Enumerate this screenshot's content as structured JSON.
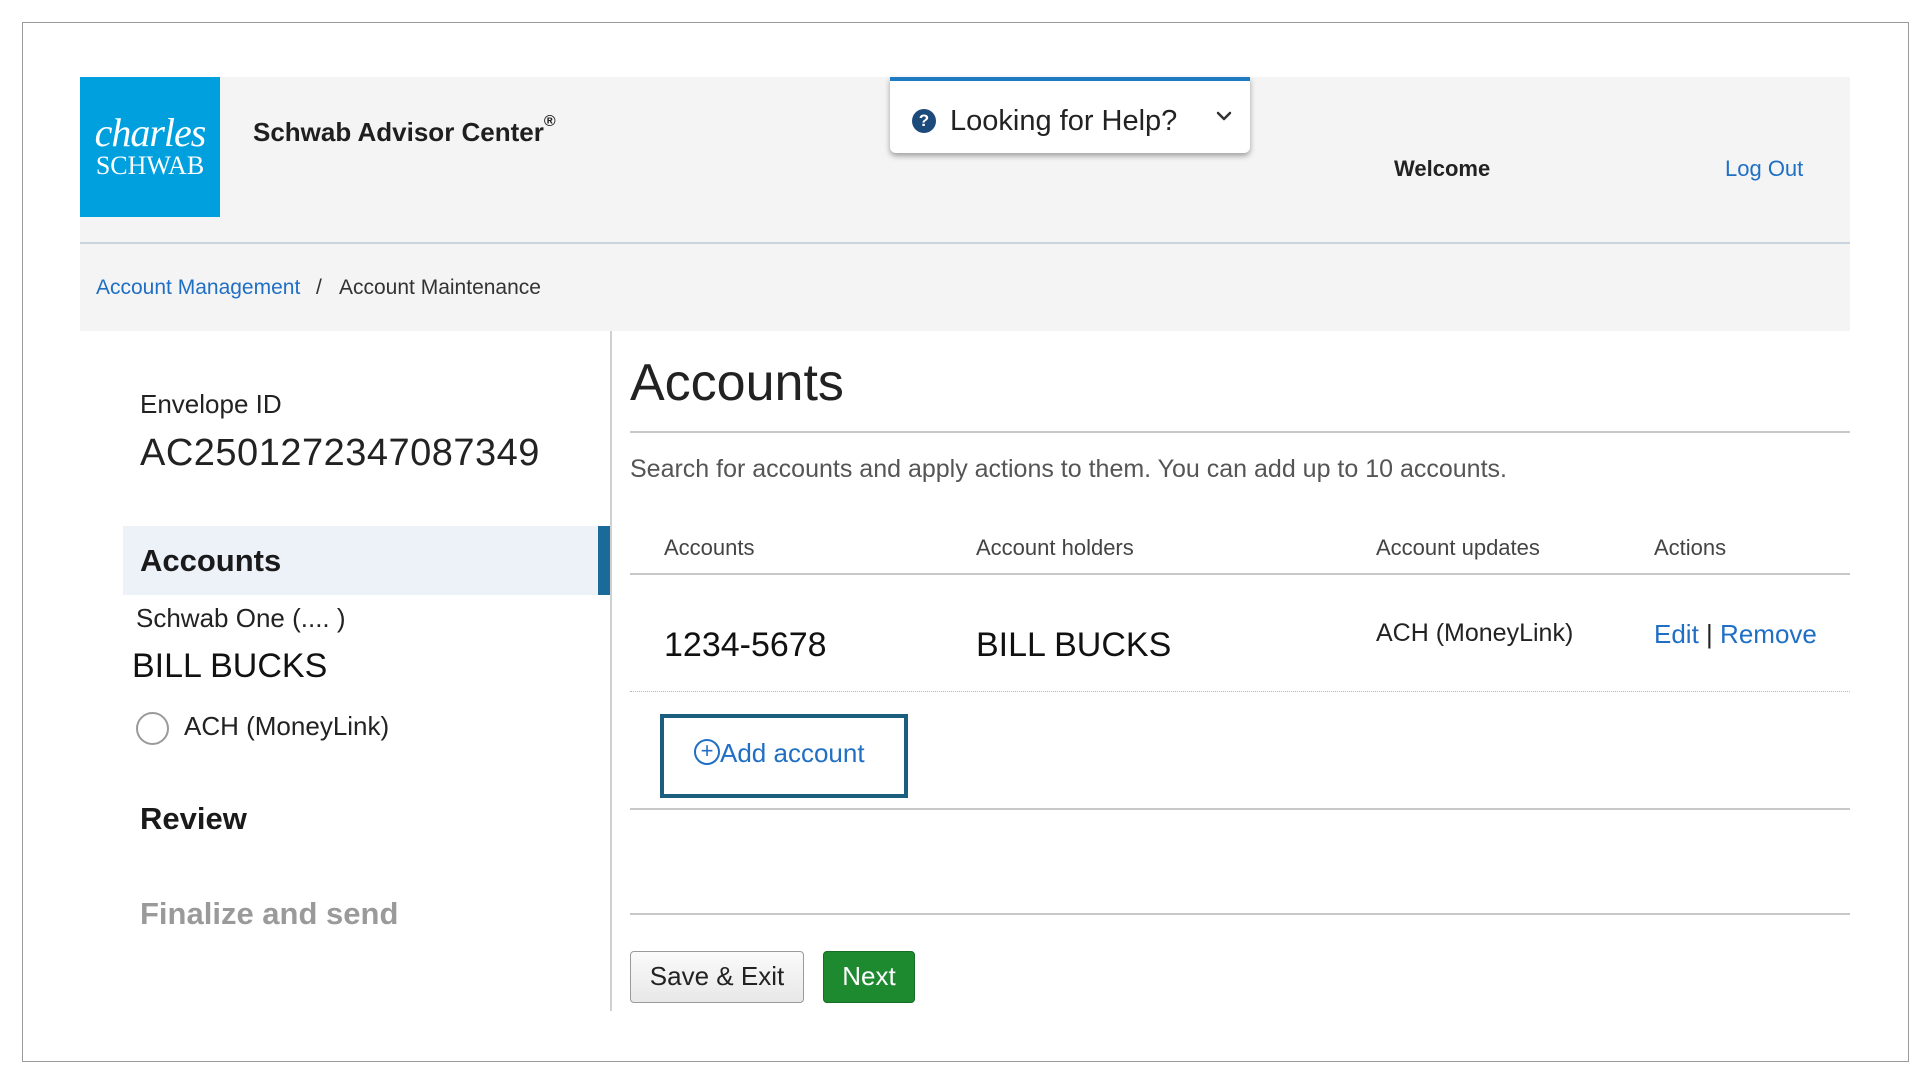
{
  "header": {
    "logo_line1": "charles",
    "logo_line2": "SCHWAB",
    "app_name": "Schwab Advisor Center",
    "app_name_mark": "®",
    "help_label": "Looking for Help?",
    "help_icon": "question-circle-icon",
    "welcome": "Welcome",
    "logout": "Log Out"
  },
  "breadcrumb": {
    "parent": "Account Management",
    "separator": "/",
    "current": "Account Maintenance"
  },
  "sidebar": {
    "envelope_label": "Envelope ID",
    "envelope_id": "AC2501272347087349",
    "steps": {
      "accounts": "Accounts",
      "review": "Review",
      "finalize": "Finalize and send"
    },
    "account_type": "Schwab One (....      )",
    "account_holder": "BILL BUCKS",
    "update_option": "ACH (MoneyLink)"
  },
  "main": {
    "title": "Accounts",
    "description": "Search for accounts and apply actions to them. You can add up to 10 accounts.",
    "table": {
      "headers": [
        "Accounts",
        "Account holders",
        "Account updates",
        "Actions"
      ],
      "rows": [
        {
          "account": "1234-5678",
          "holders": "BILL BUCKS",
          "updates": "ACH (MoneyLink)",
          "edit": "Edit",
          "sep": "|",
          "remove": "Remove"
        }
      ]
    },
    "add_account": "Add account",
    "save_exit": "Save & Exit",
    "next": "Next"
  },
  "colors": {
    "brand_blue": "#00a0df",
    "link_blue": "#1f6fc4",
    "next_green": "#1e8a2f",
    "active_step_bar": "#1b6b9a"
  }
}
